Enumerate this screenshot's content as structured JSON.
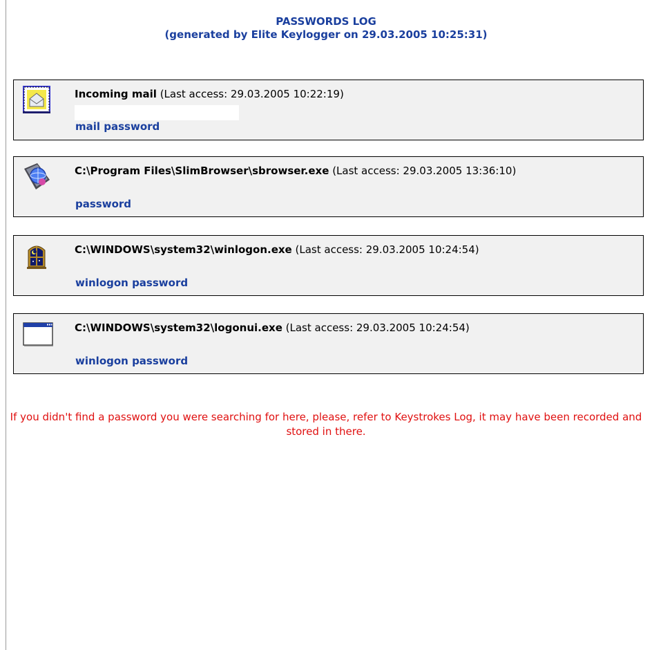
{
  "header": {
    "title": "PASSWORDS LOG",
    "subtitle": "(generated by Elite Keylogger on 29.03.2005 10:25:31)"
  },
  "entries": [
    {
      "name": "Incoming mail",
      "meta": "(Last access: 29.03.2005 10:22:19)",
      "password_label": "mail password",
      "icon": "mail-envelope-icon"
    },
    {
      "name": "C:\\Program Files\\SlimBrowser\\sbrowser.exe",
      "meta": "(Last access: 29.03.2005 13:36:10)",
      "password_label": "password",
      "icon": "browser-globe-icon"
    },
    {
      "name": "C:\\WINDOWS\\system32\\winlogon.exe",
      "meta": "(Last access: 29.03.2005 10:24:54)",
      "password_label": "winlogon password",
      "icon": "night-window-icon"
    },
    {
      "name": "C:\\WINDOWS\\system32\\logonui.exe",
      "meta": "(Last access: 29.03.2005 10:24:54)",
      "password_label": "winlogon password",
      "icon": "application-window-icon"
    }
  ],
  "notice": "If you didn't find a password you were searching for here, please, refer to Keystrokes Log, it may have been recorded and stored in there.",
  "colors": {
    "header_blue": "#1a3f9e",
    "notice_red": "#e01010",
    "entry_bg": "#f1f1f1"
  }
}
